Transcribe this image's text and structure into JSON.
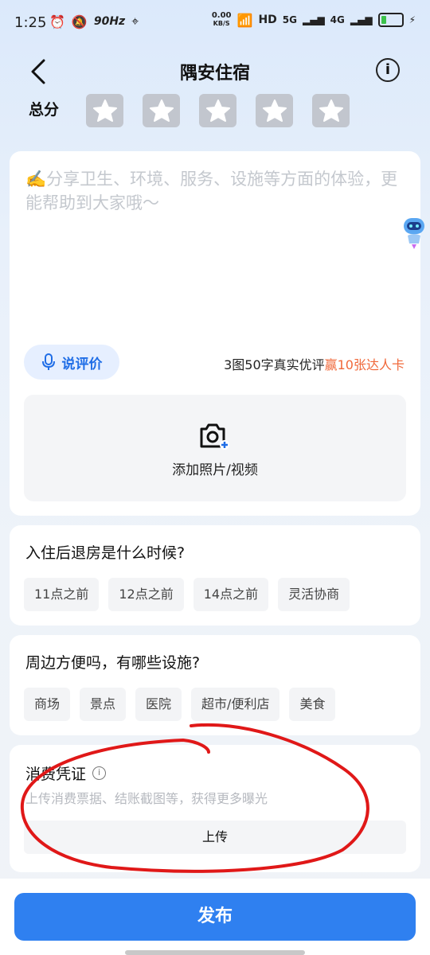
{
  "status_bar": {
    "time": "1:25",
    "refresh": "90Hz",
    "net_speed_top": "0.00",
    "net_speed_unit": "KB/S",
    "hd": "HD",
    "sig1": "5G",
    "sig2": "4G"
  },
  "header": {
    "title": "隅安住宿"
  },
  "score": {
    "label": "总分",
    "stars_filled": 0,
    "star_count": 5
  },
  "review": {
    "placeholder": "✍️分享卫生、环境、服务、设施等方面的体验，更能帮助到大家哦～",
    "voice_label": "说评价",
    "promo_text": "3图50字真实优评",
    "promo_highlight": "赢10张达人卡",
    "upload_label": "添加照片/视频"
  },
  "questions": [
    {
      "title": "入住后退房是什么时候?",
      "options": [
        "11点之前",
        "12点之前",
        "14点之前",
        "灵活协商"
      ]
    },
    {
      "title": "周边方便吗，有哪些设施?",
      "options": [
        "商场",
        "景点",
        "医院",
        "超市/便利店",
        "美食"
      ]
    }
  ],
  "receipt": {
    "title": "消费凭证",
    "subtitle": "上传消费票据、结账截图等，获得更多曝光",
    "upload_label": "上传"
  },
  "publish_label": "发布",
  "colors": {
    "accent": "#2f80f0",
    "highlight": "#f0683a",
    "annotation": "#e01818"
  }
}
